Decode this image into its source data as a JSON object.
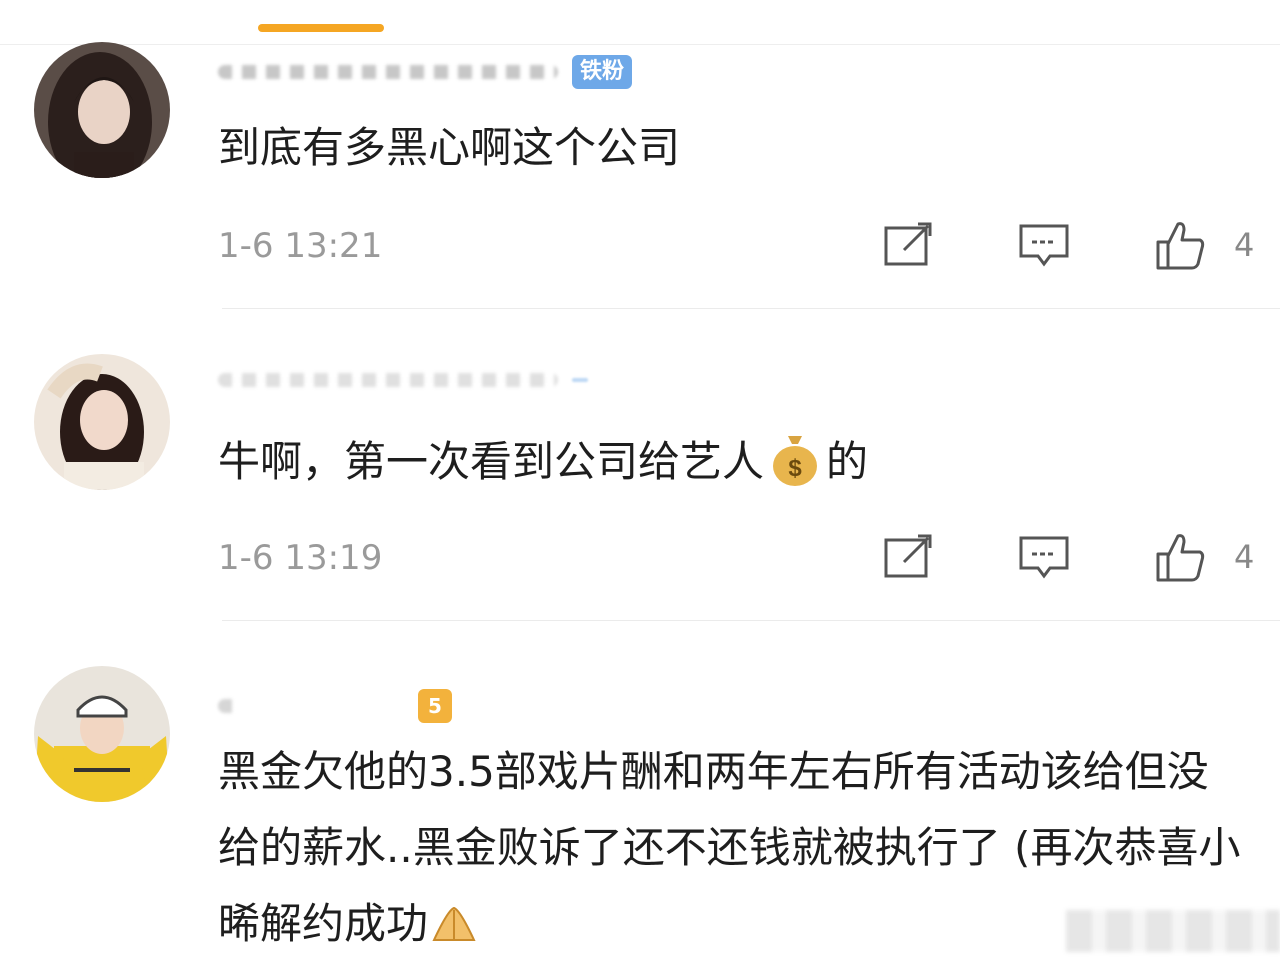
{
  "comments": [
    {
      "badge": "铁粉",
      "text": "到底有多黑心啊这个公司",
      "timestamp": "1-6 13:21",
      "likes": "4"
    },
    {
      "badge": "",
      "text_before_emoji": "牛啊，第一次看到公司给艺人",
      "emoji": "money-bag",
      "text_after_emoji": "的",
      "timestamp": "1-6 13:19",
      "likes": "4"
    },
    {
      "level_badge": "5",
      "text": "黑金欠他的3.5部戏片酬和两年左右所有活动该给但没给的薪水..黑金败诉了还不还钱就被执行了 (再次恭喜小晞解约成功",
      "emoji": "palms-together"
    }
  ],
  "colors": {
    "accent": "#f5a623",
    "fan_badge": "#6ea8e8",
    "timestamp": "#9a9a9a",
    "text": "#1e1e1e"
  },
  "icons": {
    "share": "share-edit-icon",
    "reply": "comment-bubble-icon",
    "like": "thumbs-up-icon"
  }
}
